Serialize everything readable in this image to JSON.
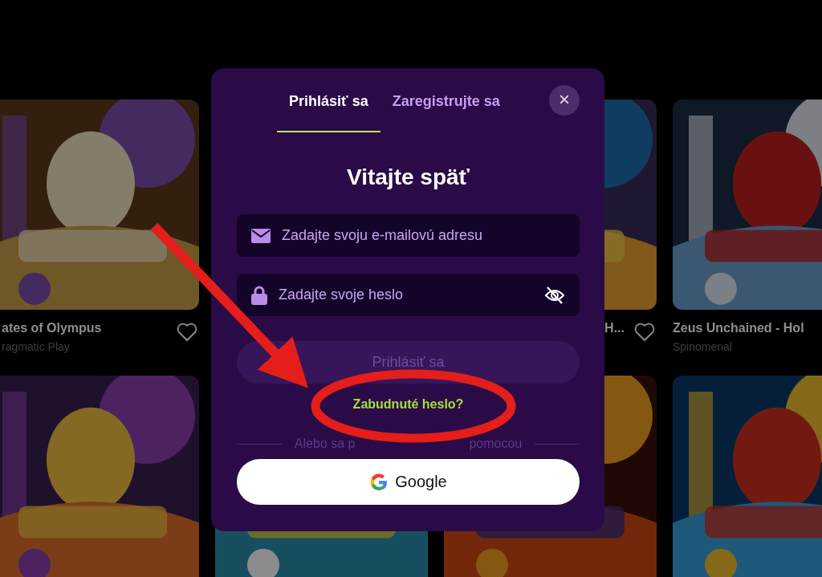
{
  "game_rows": [
    [
      {
        "kind": "picture",
        "title": "ates of Olympus",
        "provider": "ragmatic Play",
        "favorite": false
      },
      {
        "kind": "covered"
      },
      {
        "kind": "picture",
        "title": "H...",
        "favorite": false
      },
      {
        "kind": "picture",
        "title": "Zeus Unchained - Hol",
        "provider": "Spinomenal"
      }
    ],
    [
      {
        "kind": "picture"
      },
      {
        "kind": "picture"
      },
      {
        "kind": "picture"
      },
      {
        "kind": "picture"
      }
    ]
  ],
  "modal": {
    "tabs": [
      {
        "label": "Prihlásiť sa",
        "selected": true
      },
      {
        "label": "Zaregistrujte sa",
        "selected": false
      }
    ],
    "close": "×",
    "heading": "Vitajte späť",
    "email": {
      "placeholder": "Zadajte svoju e-mailovú adresu"
    },
    "password": {
      "placeholder": "Zadajte svoje heslo"
    },
    "submit": {
      "label": "Prihlásiť sa",
      "disabled": true
    },
    "forgot": "Zabudnuté heslo?",
    "divider_parts": [
      "Alebo sa p",
      "pomocou"
    ],
    "google": "Google"
  }
}
